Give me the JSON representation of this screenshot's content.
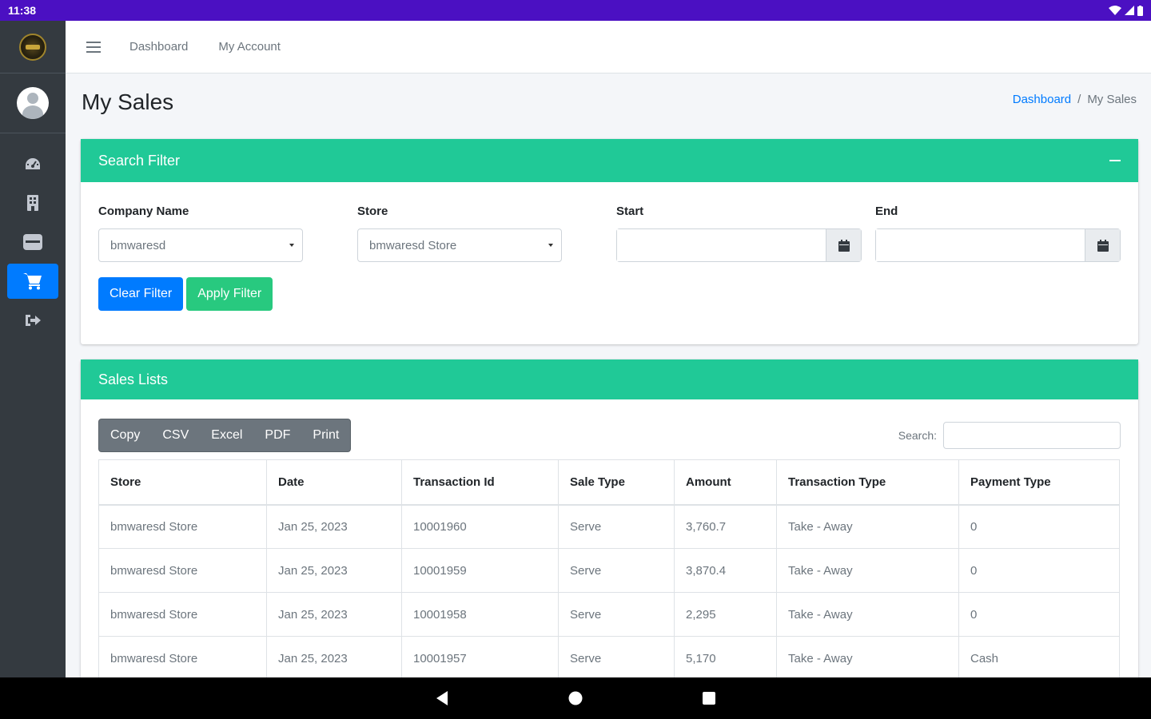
{
  "status_bar": {
    "time": "11:38"
  },
  "topnav": {
    "links": [
      "Dashboard",
      "My Account"
    ]
  },
  "page": {
    "title": "My Sales",
    "breadcrumb": {
      "home": "Dashboard",
      "separator": "/",
      "current": "My Sales"
    }
  },
  "filter": {
    "title": "Search Filter",
    "company": {
      "label": "Company Name",
      "value": "bmwaresd"
    },
    "store": {
      "label": "Store",
      "value": "bmwaresd Store"
    },
    "start": {
      "label": "Start",
      "value": ""
    },
    "end": {
      "label": "End",
      "value": ""
    },
    "clear_label": "Clear Filter",
    "apply_label": "Apply Filter"
  },
  "sales": {
    "title": "Sales Lists",
    "export_buttons": [
      "Copy",
      "CSV",
      "Excel",
      "PDF",
      "Print"
    ],
    "search_label": "Search:",
    "search_value": "",
    "columns": [
      "Store",
      "Date",
      "Transaction Id",
      "Sale Type",
      "Amount",
      "Transaction Type",
      "Payment Type"
    ],
    "rows": [
      [
        "bmwaresd Store",
        "Jan 25, 2023",
        "10001960",
        "Serve",
        "3,760.7",
        "Take - Away",
        "0"
      ],
      [
        "bmwaresd Store",
        "Jan 25, 2023",
        "10001959",
        "Serve",
        "3,870.4",
        "Take - Away",
        "0"
      ],
      [
        "bmwaresd Store",
        "Jan 25, 2023",
        "10001958",
        "Serve",
        "2,295",
        "Take - Away",
        "0"
      ],
      [
        "bmwaresd Store",
        "Jan 25, 2023",
        "10001957",
        "Serve",
        "5,170",
        "Take - Away",
        "Cash"
      ]
    ]
  },
  "colors": {
    "status_bar": "#4b10c2",
    "sidebar": "#343a40",
    "card_header": "#20c997",
    "primary": "#007bff",
    "success": "#28c97f",
    "secondary": "#6c757d"
  },
  "icons": {
    "sidebar": [
      "dashboard-icon",
      "building-icon",
      "inbox-icon",
      "cart-icon",
      "sign-out-icon"
    ],
    "date_picker": "calendar-icon",
    "android_nav": [
      "back-icon",
      "home-icon",
      "recents-icon"
    ]
  }
}
